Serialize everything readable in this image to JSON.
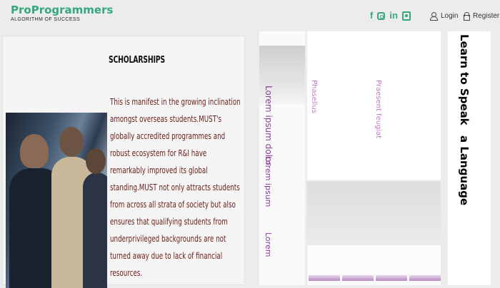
{
  "brand": {
    "title": "ProProgrammers",
    "tagline": "ALGORITHM OF SUCCESS",
    "color": "#35a87c"
  },
  "header": {
    "social_icons": [
      "facebook-icon",
      "instagram-icon",
      "linkedin-icon",
      "contact-icon"
    ],
    "social": {
      "facebook": "f",
      "linkedin": "in"
    },
    "login_label": "Login",
    "register_label": "Register"
  },
  "scholarship_card": {
    "title": "SCHOLARSHIPS",
    "body": "This is manifest in the growing inclination amongst overseas students.MUST's globally accredited programmes and robust ecosystem for R&I have remarkably improved its global standing.MUST not only attracts students from across all strata of society but also ensures that qualifying students from underprivileged backgrounds are not turned away due to lack of financial resources.",
    "text_color": "#6a1d1d"
  },
  "blurred_columns": {
    "col_a_texts": [
      "Lorem ipsum dolor",
      "Lorem ipsum",
      "Lorem"
    ],
    "col_b_texts": [
      "Phasellus",
      "Praesent feugiat"
    ],
    "col_c_texts": [
      "Learn to Speak",
      "a Language"
    ],
    "accent": "#8b3a9c"
  }
}
